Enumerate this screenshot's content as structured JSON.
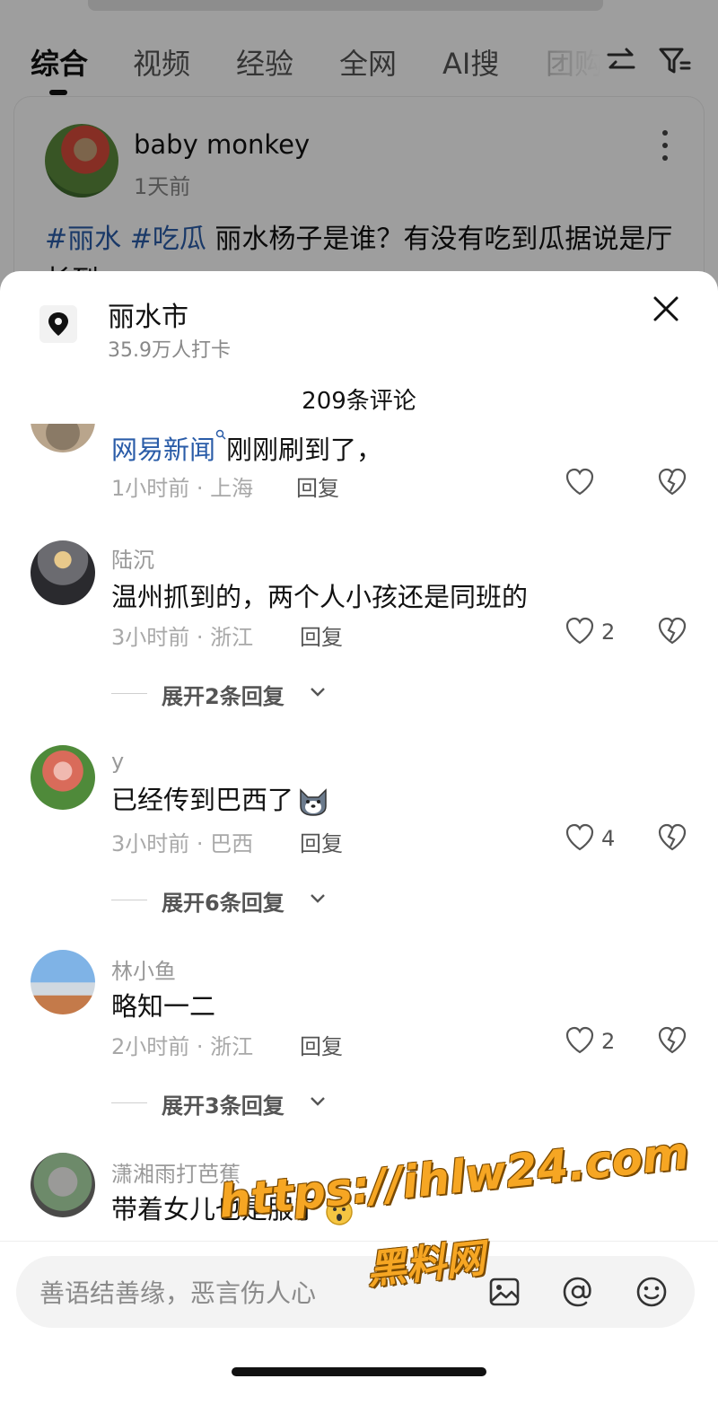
{
  "background": {
    "tabs": [
      "综合",
      "视频",
      "经验",
      "全网",
      "AI搜",
      "团购"
    ],
    "active_tab": "综合",
    "post": {
      "author": "baby monkey",
      "time": "1天前",
      "hashtags": [
        "#丽水",
        "#吃瓜"
      ],
      "text": "丽水杨子是谁？有没有吃到瓜据说是厅长到"
    }
  },
  "sheet": {
    "location_name": "丽水市",
    "location_checkins": "35.9万人打卡",
    "comment_count_title": "209条评论",
    "close_icon": "close-icon"
  },
  "comments": [
    {
      "user": "",
      "link_text": "网易新闻",
      "text": "刚刚刷到了，",
      "time": "1小时前",
      "region": "上海",
      "reply_label": "回复",
      "likes": ""
    },
    {
      "user": "陆沉",
      "text": "温州抓到的，两个人小孩还是同班的",
      "time": "3小时前",
      "region": "浙江",
      "reply_label": "回复",
      "likes": "2",
      "expand_label": "展开2条回复"
    },
    {
      "user": "y",
      "text": "已经传到巴西了",
      "emoji": "dog-emoji",
      "time": "3小时前",
      "region": "巴西",
      "reply_label": "回复",
      "likes": "4",
      "expand_label": "展开6条回复"
    },
    {
      "user": "林小鱼",
      "text": "略知一二",
      "time": "2小时前",
      "region": "浙江",
      "reply_label": "回复",
      "likes": "2",
      "expand_label": "展开3条回复"
    },
    {
      "user": "潇湘雨打芭蕉",
      "text": "带着女儿也是服了",
      "emoji": "surprised-emoji",
      "time": "",
      "region": "",
      "reply_label": "",
      "likes": ""
    }
  ],
  "composer": {
    "placeholder": "善语结善缘，恶言伤人心",
    "icons": [
      "image-icon",
      "at-icon",
      "emoji-icon"
    ]
  },
  "watermark": {
    "url": "https://ihlw24.com",
    "name": "黑料网"
  },
  "colors": {
    "link_blue": "#2a5ca8",
    "watermark_orange": "#f6a623",
    "dim_overlay": "rgba(0,0,0,0.38)"
  }
}
